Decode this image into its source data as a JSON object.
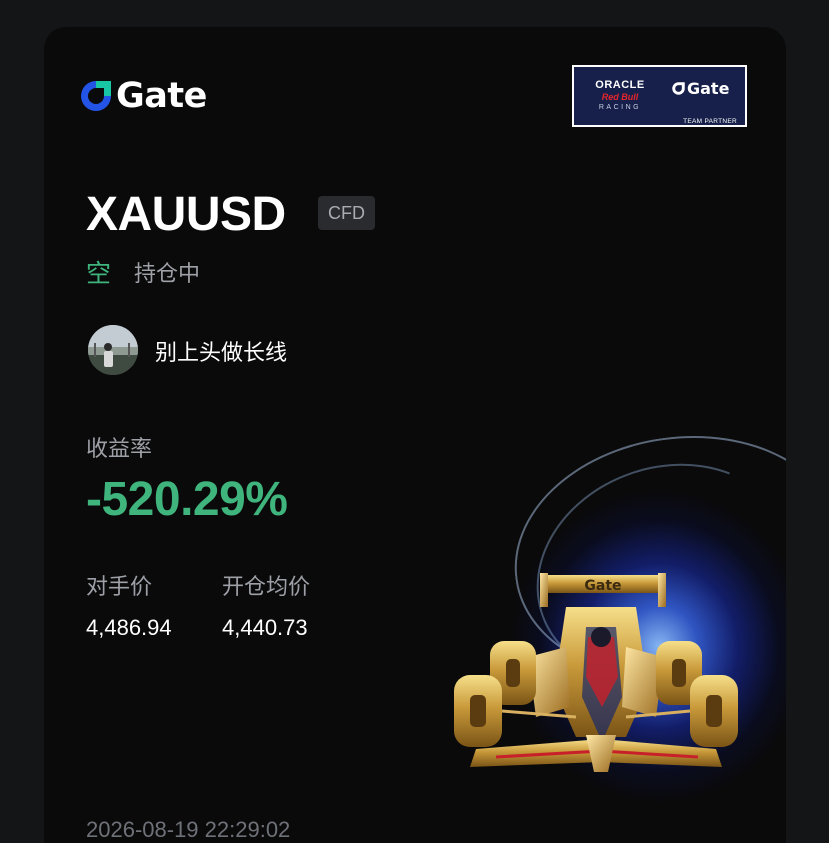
{
  "brand": {
    "name": "Gate",
    "partner": {
      "line1": "ORACLE",
      "line2": "Red Bull",
      "line3": "RACING",
      "gate": "Gate",
      "caption": "TEAM PARTNER"
    }
  },
  "position": {
    "symbol": "XAUUSD",
    "badge": "CFD",
    "side": "空",
    "status": "持仓中"
  },
  "user": {
    "name": "别上头做长线"
  },
  "roi": {
    "label": "收益率",
    "value": "-520.29%"
  },
  "prices": {
    "mark_label": "对手价",
    "mark_value": "4,486.94",
    "entry_label": "开仓均价",
    "entry_value": "4,440.73"
  },
  "timestamp": "2026-08-19 22:29:02",
  "colors": {
    "background": "#141517",
    "card": "#0a0a0b",
    "profit_loss_green": "#3fb47c",
    "brand_blue": "#2354e6",
    "muted_text": "#9da0a6"
  },
  "icons": {
    "logo": "gate-logo-icon",
    "car": "f1-car-image"
  }
}
